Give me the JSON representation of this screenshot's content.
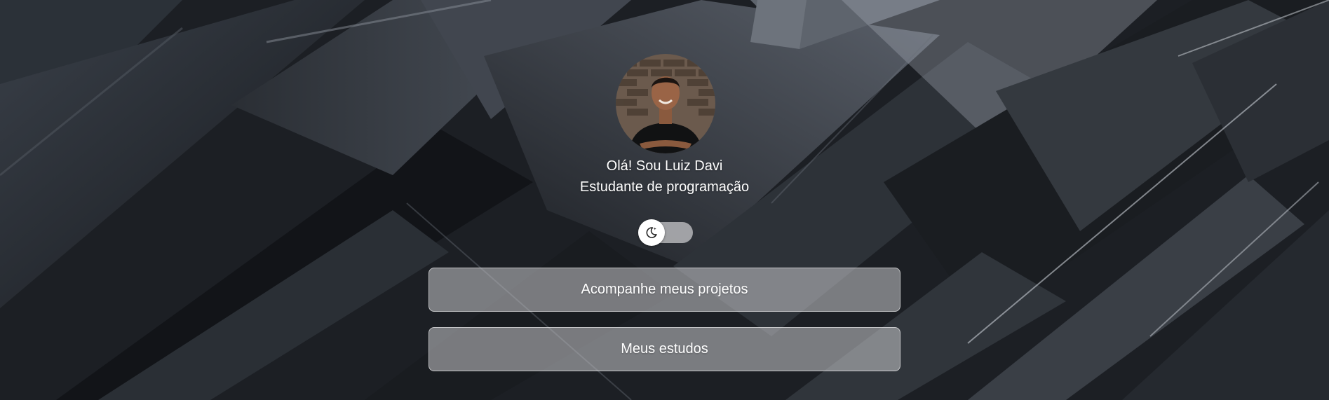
{
  "profile": {
    "greeting": "Olá! Sou Luiz Davi",
    "subtitle": "Estudante de programação",
    "avatar_alt": "Foto de Luiz Davi"
  },
  "theme_toggle": {
    "icon": "moon-star-icon",
    "state": "off"
  },
  "links": [
    {
      "label": "Acompanhe meus projetos"
    },
    {
      "label": "Meus estudos"
    }
  ],
  "colors": {
    "background": "#1b1e22",
    "button_fill": "#c8c8cc",
    "text": "#ffffff"
  }
}
